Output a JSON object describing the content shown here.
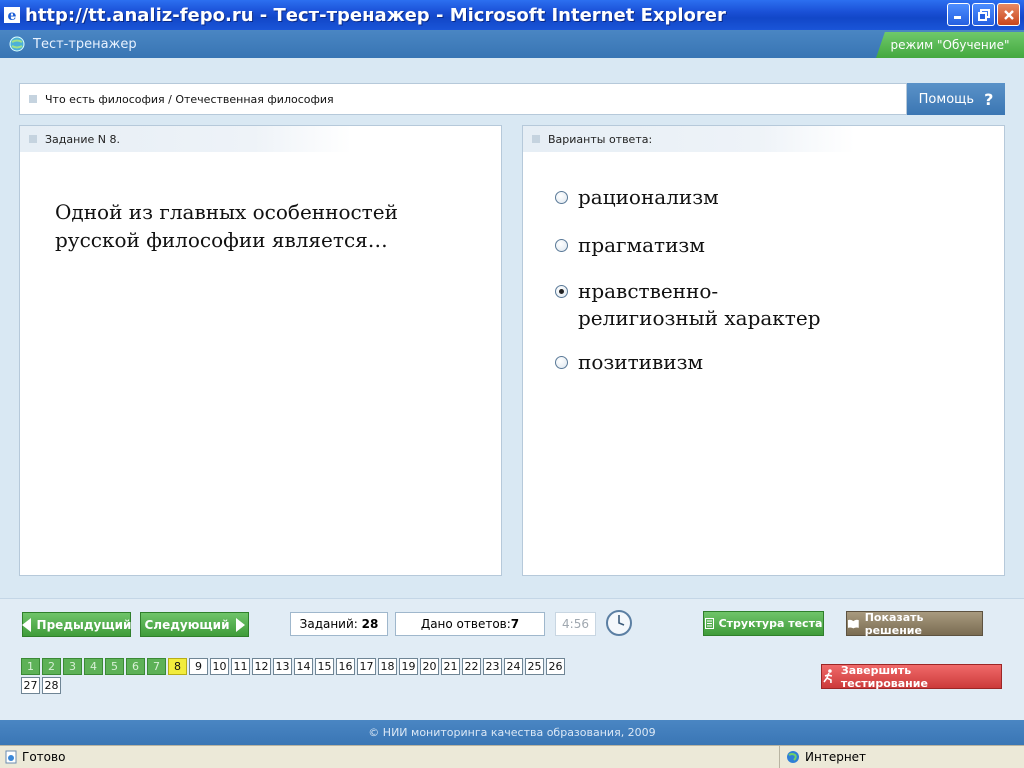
{
  "window": {
    "title": "http://tt.analiz-fepo.ru - Тест-тренажер - Microsoft Internet Explorer"
  },
  "app": {
    "title": "Тест-тренажер",
    "mode": "режим \"Обучение\""
  },
  "breadcrumb": {
    "text": "Что есть философия / Отечественная философия"
  },
  "help": {
    "label": "Помощь",
    "icon": "?"
  },
  "task": {
    "header": "Задание N 8.",
    "question": "Одной из главных особенностей русской философии является…"
  },
  "answers": {
    "header": "Варианты ответа:",
    "options": [
      {
        "label": "рационализм",
        "selected": false
      },
      {
        "label": "прагматизм",
        "selected": false
      },
      {
        "label": "нравственно-религиозный характер",
        "selected": true
      },
      {
        "label": "позитивизм",
        "selected": false
      }
    ]
  },
  "toolbar": {
    "prev_label": "Предыдущий",
    "next_label": "Следующий",
    "tasks_label": "Заданий:",
    "tasks_count": "28",
    "answered_label": "Дано ответов:",
    "answered_count": "7",
    "timer": "4:56",
    "structure_label": "Структура теста",
    "solution_label": "Показать решение",
    "finish_label": "Завершить тестирование"
  },
  "question_numbers": {
    "items": [
      "1",
      "2",
      "3",
      "4",
      "5",
      "6",
      "7",
      "8",
      "9",
      "10",
      "11",
      "12",
      "13",
      "14",
      "15",
      "16",
      "17",
      "18",
      "19",
      "20",
      "21",
      "22",
      "23",
      "24",
      "25",
      "26",
      "27",
      "28"
    ],
    "answered": [
      "1",
      "2",
      "3",
      "4",
      "5",
      "6",
      "7"
    ],
    "current": "8"
  },
  "footer": {
    "copyright": "© НИИ мониторинга качества образования, 2009"
  },
  "status": {
    "left": "Готово",
    "zone": "Интернет"
  },
  "colors": {
    "title_bar": "#1a50d6",
    "header_blue": "#3875b4",
    "green": "#4caf50",
    "current_yellow": "#f2ec3c",
    "finish_red": "#cc3a3a"
  }
}
